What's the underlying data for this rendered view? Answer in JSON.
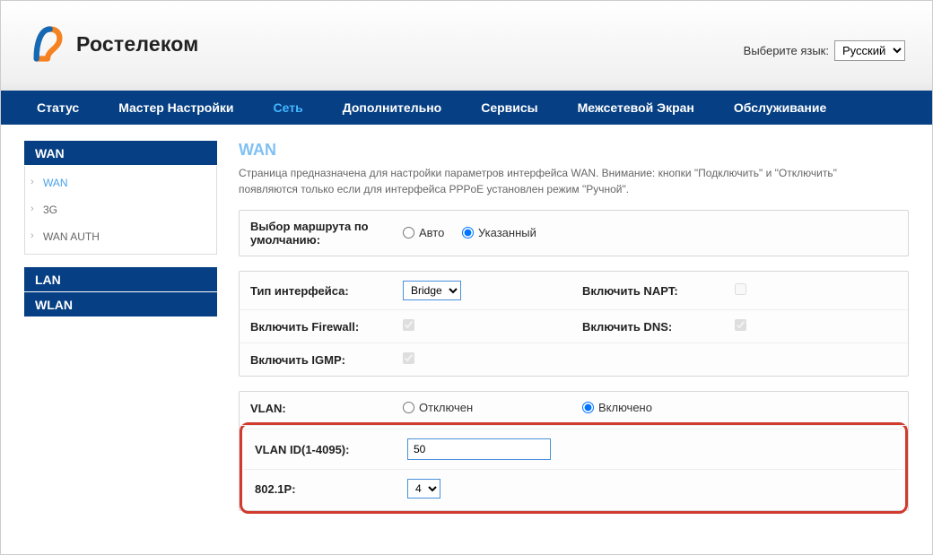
{
  "lang": {
    "label": "Выберите язык:",
    "value": "Русский"
  },
  "brand": "Ростелеком",
  "nav": {
    "status": "Статус",
    "wizard": "Мастер Настройки",
    "network": "Сеть",
    "advanced": "Дополнительно",
    "services": "Сервисы",
    "firewall": "Межсетевой Экран",
    "maintenance": "Обслуживание"
  },
  "sidebar": {
    "wan_section": "WAN",
    "wan": "WAN",
    "threeg": "3G",
    "wanauth": "WAN AUTH",
    "lan_section": "LAN",
    "wlan_section": "WLAN"
  },
  "page": {
    "title": "WAN",
    "desc": "Страница предназначена для настройки параметров интерфейса WAN. Внимание: кнопки \"Подключить\" и \"Отключить\" появляются только если для интерфейса PPPoE установлен режим \"Ручной\"."
  },
  "route": {
    "label": "Выбор маршрута по умолчанию:",
    "auto": "Авто",
    "specified": "Указанный"
  },
  "iface": {
    "type_label": "Тип интерфейса:",
    "type_value": "Bridge",
    "napt_label": "Включить NAPT:",
    "firewall_label": "Включить Firewall:",
    "dns_label": "Включить DNS:",
    "igmp_label": "Включить IGMP:"
  },
  "vlan": {
    "label": "VLAN:",
    "off": "Отключен",
    "on": "Включено",
    "id_label": "VLAN ID(1-4095):",
    "id_value": "50",
    "p_label": "802.1P:",
    "p_value": "4"
  }
}
